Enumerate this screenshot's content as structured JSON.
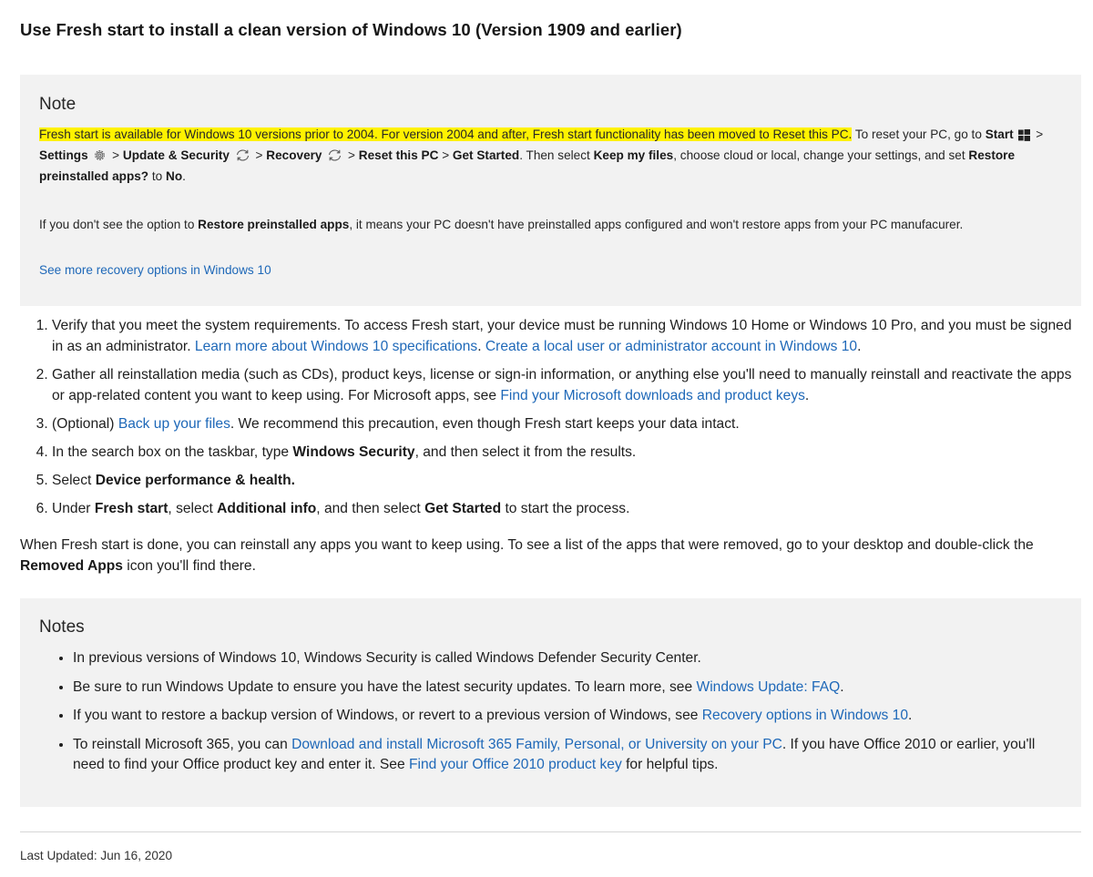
{
  "title": "Use Fresh start to install a clean version of Windows 10 (Version 1909 and earlier)",
  "note": {
    "heading": "Note",
    "highlight": "Fresh start is available for Windows 10 versions prior to 2004. For version 2004 and after, Fresh start functionality has been moved to Reset this PC.",
    "p1_t1": " To reset your PC, go to ",
    "p1_start": "Start",
    "p1_sep1": " > ",
    "p1_settings": "Settings",
    "p1_sep2": " > ",
    "p1_update": "Update & Security",
    "p1_sep3": " > ",
    "p1_recovery": "Recovery",
    "p1_sep4": " > ",
    "p1_reset": "Reset this PC",
    "p1_sep5": " > ",
    "p1_started": "Get Started",
    "p1_t2": ". Then select ",
    "p1_keep": "Keep my files",
    "p1_t3": ", choose cloud or local, change your settings, and set ",
    "p1_restore": "Restore preinstalled apps?",
    "p1_t4": " to ",
    "p1_no": "No",
    "p1_t5": ".",
    "p2_t1": "If you don't see the option to ",
    "p2_bold": "Restore preinstalled apps",
    "p2_t2": ", it means your PC doesn't have preinstalled apps configured and won't restore apps from your PC manufacurer.",
    "link": "See more recovery options in Windows 10"
  },
  "steps": {
    "s1_t1": "Verify that you meet the system requirements. To access Fresh start, your device must be running Windows 10 Home or Windows 10 Pro, and you must be signed in as an administrator. ",
    "s1_link1": "Learn more about Windows 10 specifications",
    "s1_t2": ". ",
    "s1_link2": "Create a local user or administrator account in Windows 10",
    "s1_t3": ".",
    "s2_t1": "Gather all reinstallation media (such as CDs), product keys, license or sign-in information, or anything else you'll need to manually reinstall and reactivate the apps or app-related content you want to keep using. For Microsoft apps, see ",
    "s2_link": "Find your Microsoft downloads and product keys",
    "s2_t2": ".",
    "s3_t1": "(Optional) ",
    "s3_link": "Back up your files",
    "s3_t2": ". We recommend this precaution, even though Fresh start keeps your data intact.",
    "s4_t1": "In the search box on the taskbar, type ",
    "s4_bold": "Windows Security",
    "s4_t2": ", and then select it from the results.",
    "s5_t1": "Select ",
    "s5_bold": "Device performance & health.",
    "s6_t1": "Under ",
    "s6_b1": "Fresh start",
    "s6_t2": ", select ",
    "s6_b2": "Additional info",
    "s6_t3": ", and then select ",
    "s6_b3": "Get Started",
    "s6_t4": " to start the process."
  },
  "after": {
    "t1": "When Fresh start is done, you can reinstall any apps you want to keep using. To see a list of the apps that were removed, go to your desktop and double-click the ",
    "bold": "Removed Apps",
    "t2": " icon you'll find there."
  },
  "notes": {
    "heading": "Notes",
    "n1": "In previous versions of Windows 10, Windows Security is called Windows Defender Security Center.",
    "n2_t1": "Be sure to run Windows Update to ensure you have the latest security updates. To learn more, see ",
    "n2_link": "Windows Update: FAQ",
    "n2_t2": ".",
    "n3_t1": "If you want to restore a backup version of Windows, or revert to a previous version of Windows, see ",
    "n3_link": "Recovery options in Windows 10",
    "n3_t2": ".",
    "n4_t1": "To reinstall Microsoft 365, you can ",
    "n4_link1": "Download and install Microsoft 365 Family, Personal, or University on your PC",
    "n4_t2": ". If you have Office 2010 or earlier, you'll need to find your Office product key and enter it. See ",
    "n4_link2": "Find your Office 2010 product key",
    "n4_t3": " for helpful tips."
  },
  "last_updated": "Last Updated: Jun 16, 2020",
  "colors": {
    "link": "#1e68b8",
    "highlight": "#fff200",
    "alert_bg": "#f2f2f2"
  },
  "icons": [
    "windows-logo-icon",
    "gear-icon",
    "sync-icon"
  ]
}
